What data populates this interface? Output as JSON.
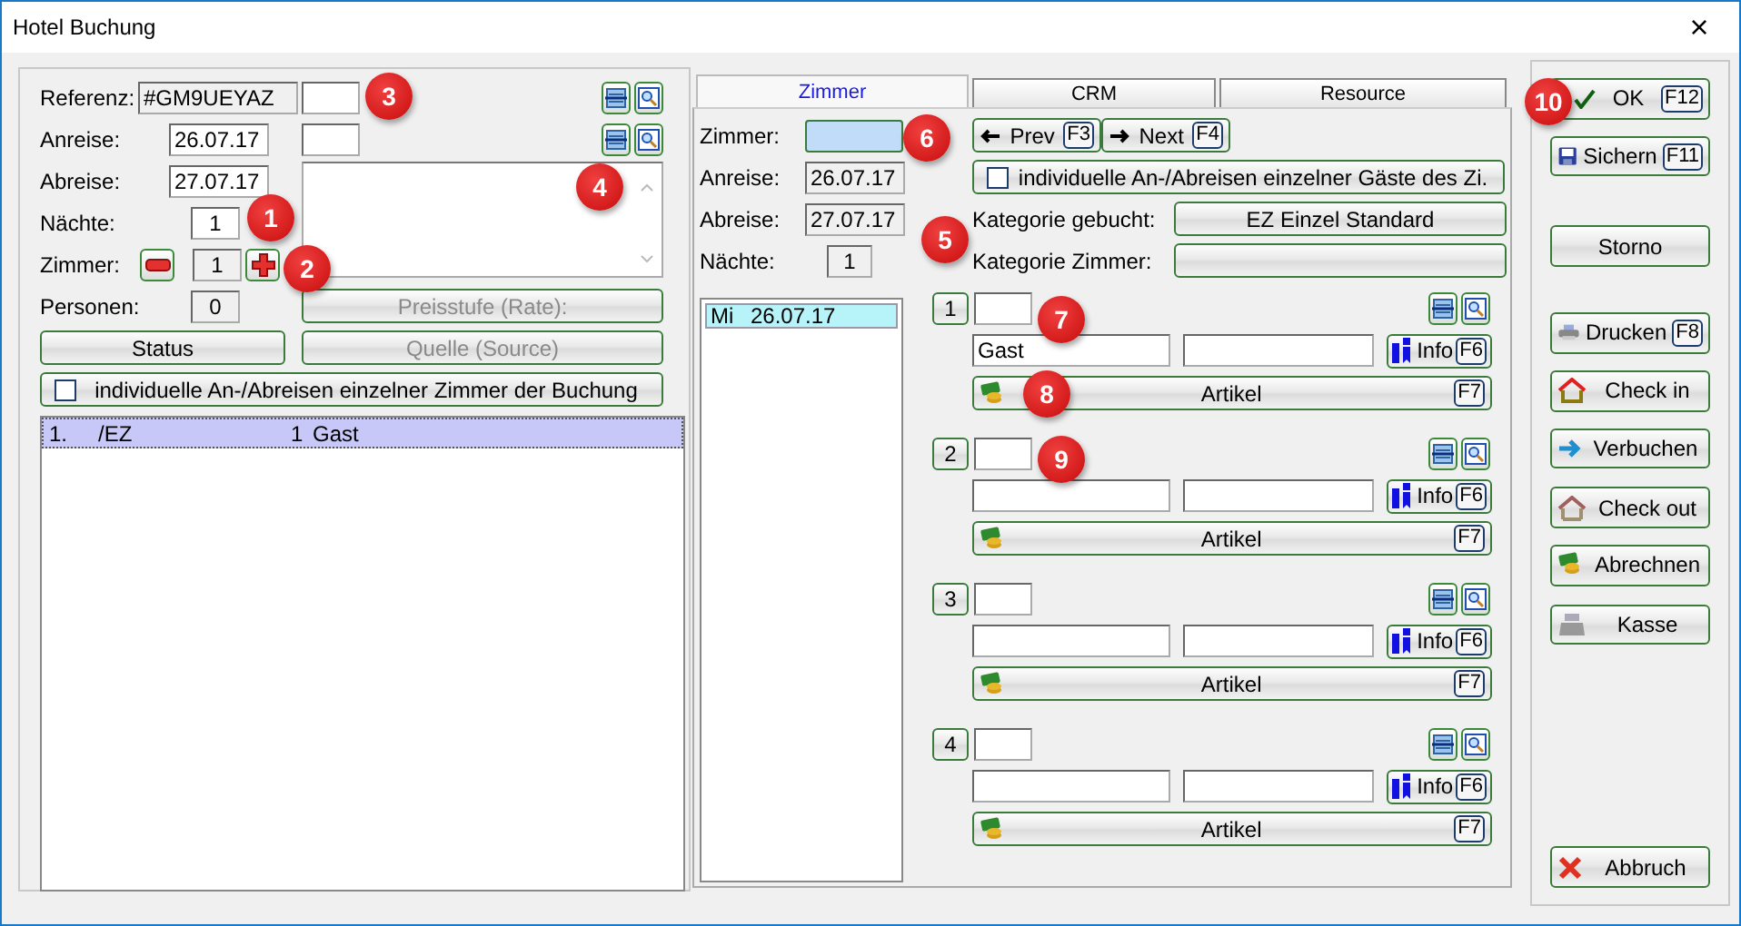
{
  "window": {
    "title": "Hotel Buchung",
    "close": "×"
  },
  "booking": {
    "reference": {
      "label": "Referenz:",
      "value": "#GM9UEYAZ"
    },
    "arrival": {
      "label": "Anreise:",
      "value": "26.07.17"
    },
    "departure": {
      "label": "Abreise:",
      "value": "27.07.17"
    },
    "nights": {
      "label": "Nächte:",
      "value": "1"
    },
    "rooms": {
      "label": "Zimmer:",
      "value": "1"
    },
    "persons": {
      "label": "Personen:",
      "value": "0"
    },
    "rate_button": {
      "label": "Preisstufe (Rate):",
      "disabled": true
    },
    "status_button": {
      "label": "Status",
      "disabled": false
    },
    "source_button": {
      "label": "Quelle (Source)",
      "disabled": true
    },
    "individual_rooms": {
      "label": "individuelle An-/Abreisen einzelner Zimmer der Buchung",
      "checked": false
    },
    "room_list": [
      {
        "number": "1.",
        "category": "/EZ",
        "count": "1",
        "guest": "Gast",
        "selected": true
      }
    ]
  },
  "tabs": [
    {
      "label": "Zimmer",
      "selected": true
    },
    {
      "label": "CRM",
      "selected": false
    },
    {
      "label": "Resource",
      "selected": false
    }
  ],
  "room": {
    "room": {
      "label": "Zimmer:"
    },
    "arrival": {
      "label": "Anreise:",
      "value": "26.07.17"
    },
    "departure": {
      "label": "Abreise:",
      "value": "27.07.17"
    },
    "nights": {
      "label": "Nächte:",
      "value": "1"
    },
    "prev": {
      "label": "Prev",
      "key": "F3"
    },
    "next": {
      "label": "Next",
      "key": "F4"
    },
    "individual_guests": {
      "label": "individuelle An-/Abreisen einzelner Gäste des Zi.",
      "checked": false
    },
    "category_booked": {
      "label": "Kategorie gebucht:",
      "value": "EZ Einzel Standard"
    },
    "category_room": {
      "label": "Kategorie Zimmer:"
    },
    "days": [
      {
        "day": "Mi",
        "date": "26.07.17",
        "selected": true
      }
    ],
    "guests": [
      {
        "number": "1",
        "name": "Gast",
        "info": "Info",
        "info_key": "F6",
        "articles": "Artikel",
        "articles_key": "F7"
      },
      {
        "number": "2",
        "info": "Info",
        "info_key": "F6",
        "articles": "Artikel",
        "articles_key": "F7"
      },
      {
        "number": "3",
        "info": "Info",
        "info_key": "F6",
        "articles": "Artikel",
        "articles_key": "F7"
      },
      {
        "number": "4",
        "info": "Info",
        "info_key": "F6",
        "articles": "Artikel",
        "articles_key": "F7"
      }
    ]
  },
  "actions": [
    {
      "kind": "check",
      "label": "OK",
      "key": "F12"
    },
    {
      "kind": "disk",
      "label": "Sichern",
      "key": "F11"
    },
    {
      "kind": "plain",
      "label": "Storno"
    },
    {
      "kind": "printer",
      "label": "Drucken",
      "key": "F8"
    },
    {
      "kind": "checkin",
      "label": "Check in"
    },
    {
      "kind": "arrow",
      "label": "Verbuchen"
    },
    {
      "kind": "checkout",
      "label": "Check out"
    },
    {
      "kind": "money",
      "label": "Abrechnen"
    },
    {
      "kind": "register",
      "label": "Kasse"
    },
    {
      "kind": "cancel",
      "label": "Abbruch"
    }
  ],
  "callouts": [
    "1",
    "2",
    "3",
    "4",
    "5",
    "6",
    "7",
    "8",
    "9",
    "10"
  ]
}
